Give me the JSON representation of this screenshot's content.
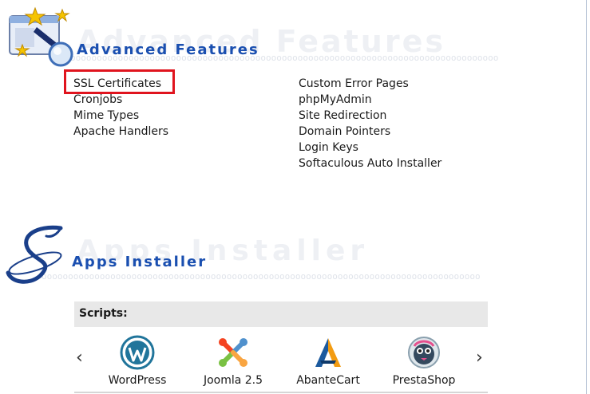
{
  "advanced_features": {
    "watermark": "Advanced Features",
    "title": "Advanced Features",
    "left_links": [
      "SSL Certificates",
      "Cronjobs",
      "Mime Types",
      "Apache Handlers"
    ],
    "right_links": [
      "Custom Error Pages",
      "phpMyAdmin",
      "Site Redirection",
      "Domain Pointers",
      "Login Keys",
      "Softaculous Auto Installer"
    ],
    "highlighted": "SSL Certificates",
    "highlight_color": "#e0141e"
  },
  "apps_installer": {
    "watermark": "Apps Installer",
    "title": "Apps Installer",
    "scripts_label": "Scripts:",
    "prev_arrow": "‹",
    "next_arrow": "›",
    "scripts": [
      {
        "name": "WordPress",
        "icon": "wordpress-icon"
      },
      {
        "name": "Joomla 2.5",
        "icon": "joomla-icon"
      },
      {
        "name": "AbanteCart",
        "icon": "abantecart-icon"
      },
      {
        "name": "PrestaShop",
        "icon": "prestashop-icon"
      }
    ]
  },
  "colors": {
    "title_blue": "#1a4fb0",
    "watermark": "#eef0f4",
    "scripts_bar": "#e8e8e8"
  }
}
